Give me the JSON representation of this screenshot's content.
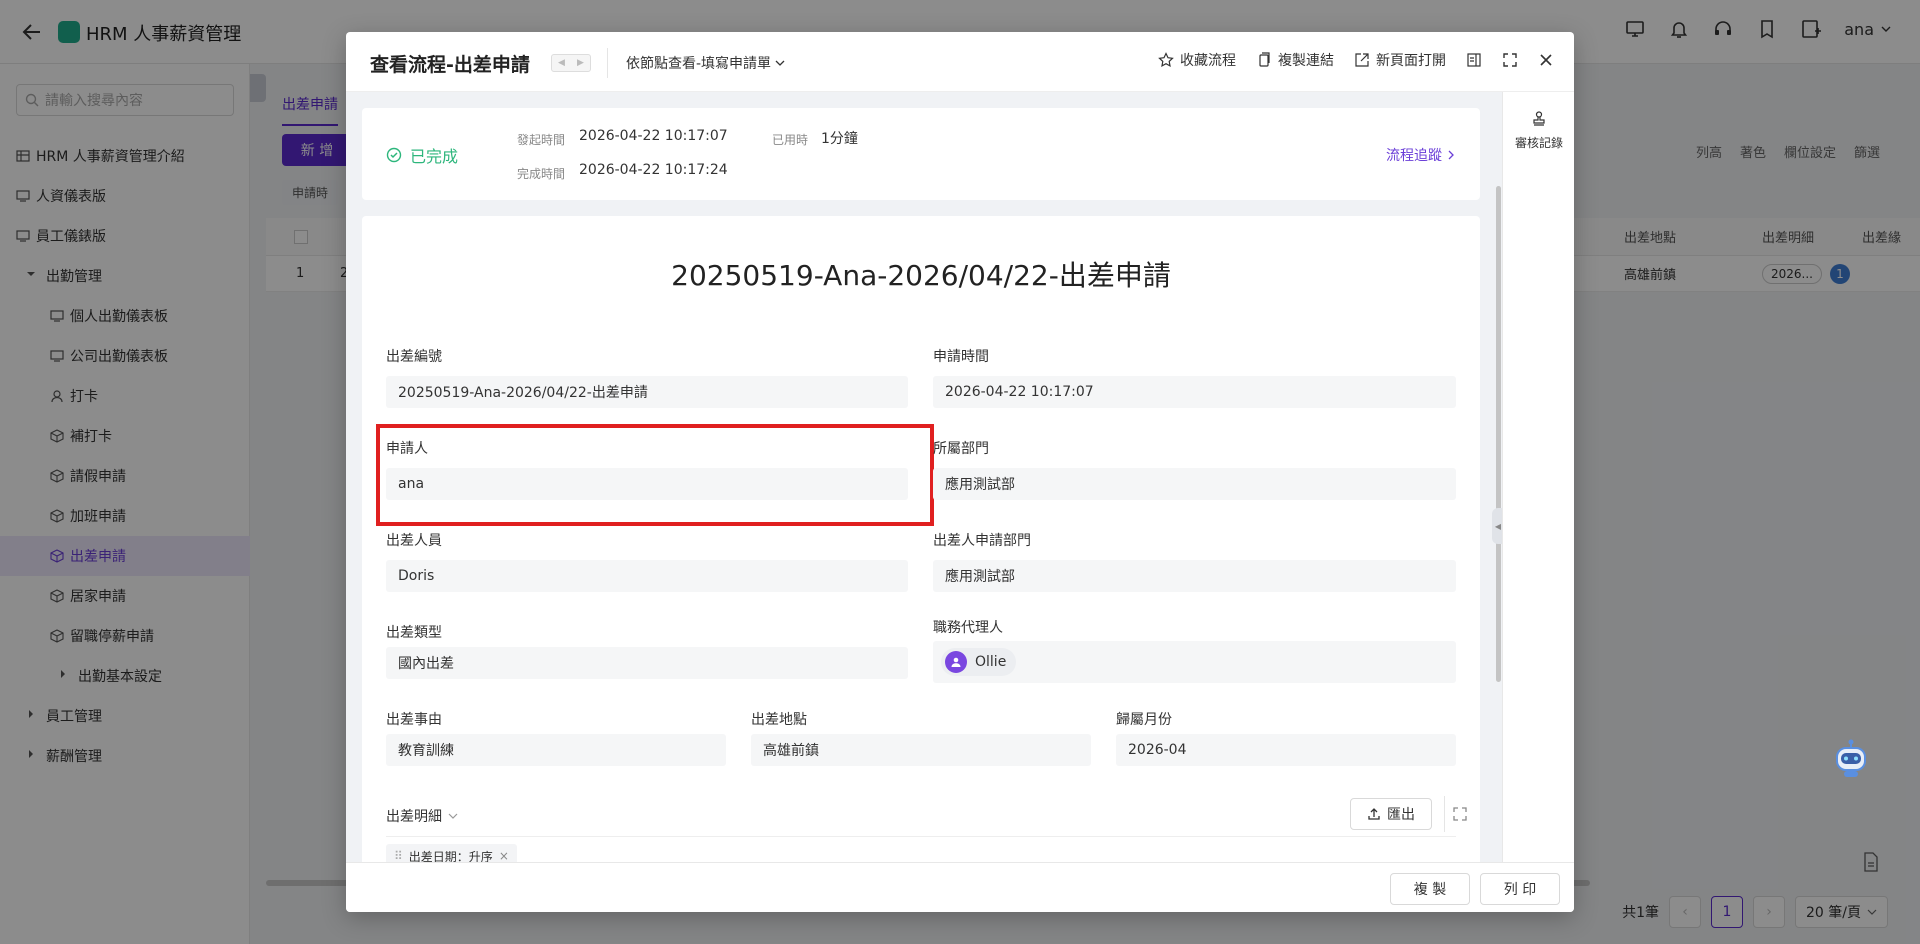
{
  "app": {
    "title": "HRM 人事薪資管理",
    "user": "ana"
  },
  "sidebar": {
    "search_placeholder": "請輸入搜尋內容",
    "items": [
      {
        "label": "HRM 人事薪資管理介紹"
      },
      {
        "label": "人資儀表版"
      },
      {
        "label": "員工儀錶版"
      },
      {
        "label": "出勤管理"
      },
      {
        "label": "個人出勤儀表板"
      },
      {
        "label": "公司出勤儀表板"
      },
      {
        "label": "打卡"
      },
      {
        "label": "補打卡"
      },
      {
        "label": "請假申請"
      },
      {
        "label": "加班申請"
      },
      {
        "label": "出差申請"
      },
      {
        "label": "居家申請"
      },
      {
        "label": "留職停薪申請"
      },
      {
        "label": "出勤基本設定"
      },
      {
        "label": "員工管理"
      },
      {
        "label": "薪酬管理"
      }
    ]
  },
  "content": {
    "tab": "出差申請",
    "new_label": "新 增",
    "tools": [
      "列高",
      "著色",
      "欄位設定",
      "篩選"
    ],
    "filter_chip": "申請時",
    "headers": {
      "location": "出差地點",
      "detail": "出差明細",
      "extra": "出差緣"
    },
    "row": {
      "index": "1",
      "idx2": "2",
      "location": "高雄前鎮",
      "detail": "2026...",
      "count": "1"
    },
    "pager": {
      "total": "共1筆",
      "page": "1",
      "size": "20 筆/頁"
    }
  },
  "modal": {
    "title": "查看流程-出差申請",
    "view_mode": "依節點查看-填寫申請單",
    "actions": {
      "favorite": "收藏流程",
      "copy_link": "複製連結",
      "open_new": "新頁面打開"
    },
    "side": {
      "audit": "審核記錄"
    },
    "status": {
      "label": "已完成",
      "start_label": "發起時間",
      "start_value": "2026-04-22 10:17:07",
      "used_label": "已用時",
      "used_value": "1分鐘",
      "end_label": "完成時間",
      "end_value": "2026-04-22 10:17:24",
      "trace": "流程追蹤"
    },
    "form": {
      "doc_title": "20250519-Ana-2026/04/22-出差申請",
      "trip_no": {
        "label": "出差編號",
        "value": "20250519-Ana-2026/04/22-出差申請"
      },
      "apply_time": {
        "label": "申請時間",
        "value": "2026-04-22 10:17:07"
      },
      "applicant": {
        "label": "申請人",
        "value": "ana"
      },
      "dept": {
        "label": "所屬部門",
        "value": "應用測試部"
      },
      "traveler": {
        "label": "出差人員",
        "value": "Doris"
      },
      "traveler_dept": {
        "label": "出差人申請部門",
        "value": "應用測試部"
      },
      "trip_type": {
        "label": "出差類型",
        "value": "國內出差"
      },
      "agent": {
        "label": "職務代理人",
        "value": "Ollie"
      },
      "reason": {
        "label": "出差事由",
        "value": "教育訓練"
      },
      "location": {
        "label": "出差地點",
        "value": "高雄前鎮"
      },
      "month": {
        "label": "歸屬月份",
        "value": "2026-04"
      },
      "detail": {
        "label": "出差明細",
        "export": "匯出",
        "sort_chip": "出差日期：升序"
      }
    },
    "footer": {
      "copy": "複 製",
      "print": "列 印"
    }
  },
  "colors": {
    "accent": "#5b2bd0",
    "success": "#2db67c",
    "highlight": "#e02020"
  }
}
